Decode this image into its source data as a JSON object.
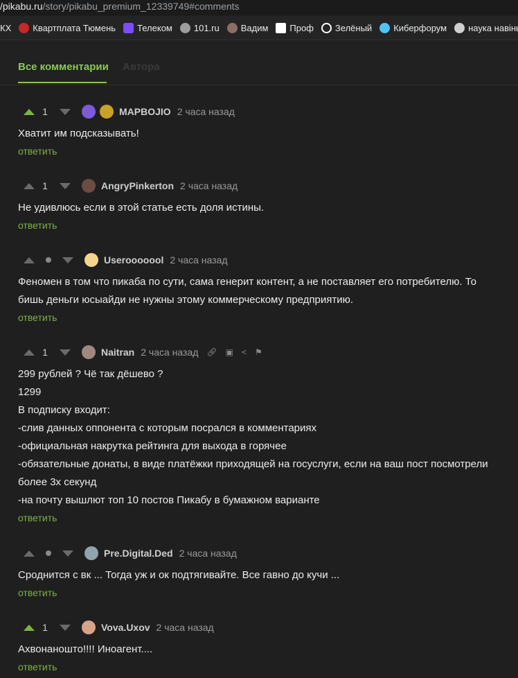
{
  "url": {
    "host": "/pikabu.ru",
    "path": "/story/pikabu_premium_12339749#comments"
  },
  "bookmarks": [
    {
      "label": "КХ",
      "icon": "none",
      "color": "#000000"
    },
    {
      "label": "Квартплата Тюмень",
      "icon": "kvartplata-icon",
      "color": "#c62828"
    },
    {
      "label": "Телеком",
      "icon": "telecom-icon",
      "color": "#7c4dff"
    },
    {
      "label": "101.ru",
      "icon": "radio-icon",
      "color": "#9e9e9e"
    },
    {
      "label": "Вадим",
      "icon": "person-icon",
      "color": "#8d6e63"
    },
    {
      "label": "Проф",
      "icon": "prof-icon",
      "color": "#ffffff"
    },
    {
      "label": "Зелёный",
      "icon": "globe-icon",
      "color": "#ffffff"
    },
    {
      "label": "Киберфорум",
      "icon": "cyberforum-icon",
      "color": "#4fc3f7"
    },
    {
      "label": "наука навіны",
      "icon": "science-icon",
      "color": "#cfcfcf"
    }
  ],
  "tabs": {
    "active": "Все комментарии",
    "inactive": "Автора"
  },
  "comments": [
    {
      "user": "MAPBOJIO",
      "time": "2 часа назад",
      "votes": "1",
      "voted_up": true,
      "lines": [
        "Хватит им подсказывать!"
      ],
      "reply": "ответить",
      "avatar_color": "#7b5cd6",
      "badge": true
    },
    {
      "user": "AngryPinkerton",
      "time": "2 часа назад",
      "votes": "1",
      "voted_up": false,
      "lines": [
        "Не удивлюсь если в этой статье есть доля истины."
      ],
      "reply": "ответить",
      "avatar_color": "#6d4c41"
    },
    {
      "user": "Userooooool",
      "time": "2 часа назад",
      "votes": "",
      "voted_up": false,
      "lines": [
        "Феномен в том что пикаба по сути, сама генерит контент, а не поставляет его потребителю. То",
        "бишь деньги юсыайди не нужны этому коммерческому предприятию."
      ],
      "reply": "ответить",
      "avatar_color": "#f4d58a"
    },
    {
      "user": "Naitran",
      "time": "2 часа назад",
      "votes": "1",
      "voted_up": false,
      "lines": [
        "299 рублей ? Чё так дёшево ?",
        "1299",
        "В подписку входит:",
        "-слив данных оппонента с которым посрался в комментариях",
        "-официальная накрутка рейтинга для выхода в горячее",
        "-обязательные донаты, в виде платёжки приходящей на госуслуги, если на ваш пост посмотрели",
        "более 3х секунд",
        "-на почту вышлют топ 10 постов Пикабу в бумажном варианте"
      ],
      "reply": "ответить",
      "avatar_color": "#a1887f",
      "tools": true
    },
    {
      "user": "Pre.Digital.Ded",
      "time": "2 часа назад",
      "votes": "",
      "voted_up": false,
      "lines": [
        "Сроднится с вк ... Тогда уж и ок подтягивайте. Все гавно до кучи ..."
      ],
      "reply": "ответить",
      "avatar_color": "#90a4ae"
    },
    {
      "user": "Vova.Uxov",
      "time": "2 часа назад",
      "votes": "1",
      "voted_up": true,
      "lines": [
        "Ахвонаношто!!!! Иноагент...."
      ],
      "reply": "ответить",
      "avatar_color": "#d7a38a"
    }
  ]
}
